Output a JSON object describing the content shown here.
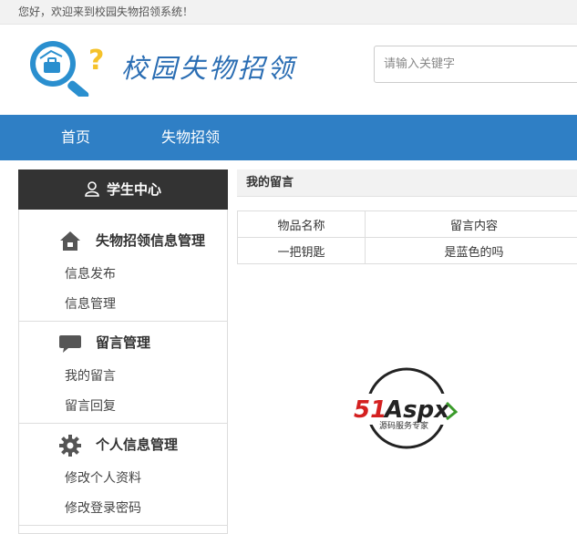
{
  "topbar": {
    "welcome": "您好，欢迎来到校园失物招领系统！"
  },
  "header": {
    "site_title": "校园失物招领",
    "search_placeholder": "请输入关键字"
  },
  "nav": {
    "items": [
      "首页",
      "失物招领"
    ]
  },
  "sidebar": {
    "heading": "学生中心",
    "groups": [
      {
        "title": "失物招领信息管理",
        "icon": "home-icon",
        "links": [
          "信息发布",
          "信息管理"
        ]
      },
      {
        "title": "留言管理",
        "icon": "comment-icon",
        "links": [
          "我的留言",
          "留言回复"
        ]
      },
      {
        "title": "个人信息管理",
        "icon": "gear-icon",
        "links": [
          "修改个人资料",
          "修改登录密码"
        ]
      }
    ]
  },
  "main": {
    "heading": "我的留言",
    "table": {
      "headers": [
        "物品名称",
        "留言内容"
      ],
      "rows": [
        [
          "一把钥匙",
          "是蓝色的吗"
        ]
      ]
    }
  },
  "watermark": {
    "brand": "51Aspx",
    "tagline": "源码服务专家"
  },
  "colors": {
    "nav": "#2f7fc5",
    "sidebar_head": "#333333",
    "title": "#2a6db3"
  }
}
